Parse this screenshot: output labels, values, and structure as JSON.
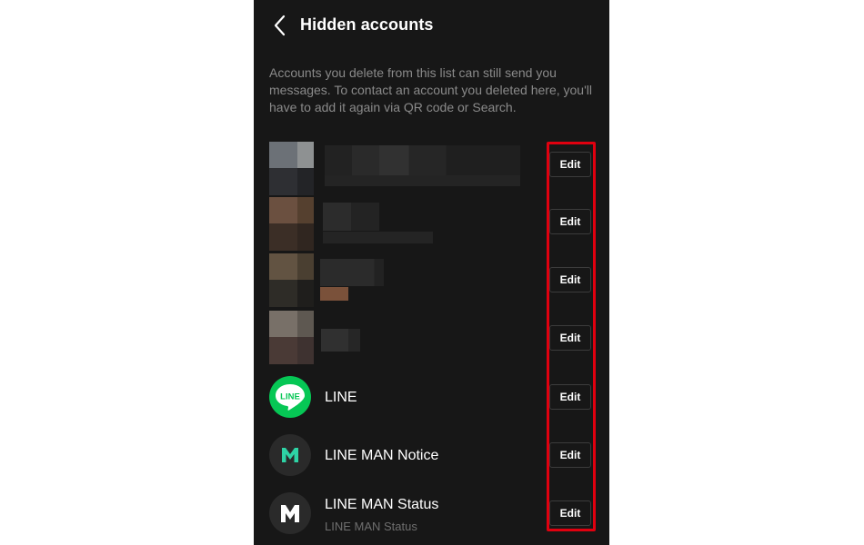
{
  "header": {
    "title": "Hidden accounts",
    "back_icon": "chevron-left-icon"
  },
  "description": "Accounts you delete from this list can still send you messages. To contact an account you deleted here, you'll have to add it again via QR code or Search.",
  "accounts": [
    {
      "name": "",
      "subtitle": "",
      "edit_label": "Edit"
    },
    {
      "name": "",
      "subtitle": "",
      "edit_label": "Edit"
    },
    {
      "name": "",
      "subtitle": "",
      "edit_label": "Edit"
    },
    {
      "name": "",
      "subtitle": "",
      "edit_label": "Edit"
    },
    {
      "name": "LINE",
      "subtitle": "",
      "edit_label": "Edit",
      "icon": "line-logo-icon"
    },
    {
      "name": "LINE MAN Notice",
      "subtitle": "",
      "edit_label": "Edit",
      "icon": "line-man-logo-icon"
    },
    {
      "name": "LINE MAN Status",
      "subtitle": "LINE MAN Status",
      "edit_label": "Edit",
      "icon": "line-man-logo-icon"
    }
  ],
  "colors": {
    "background": "#171717",
    "highlight": "#e0000f",
    "line_green": "#06c755",
    "line_man_teal": "#2ed3a5"
  }
}
